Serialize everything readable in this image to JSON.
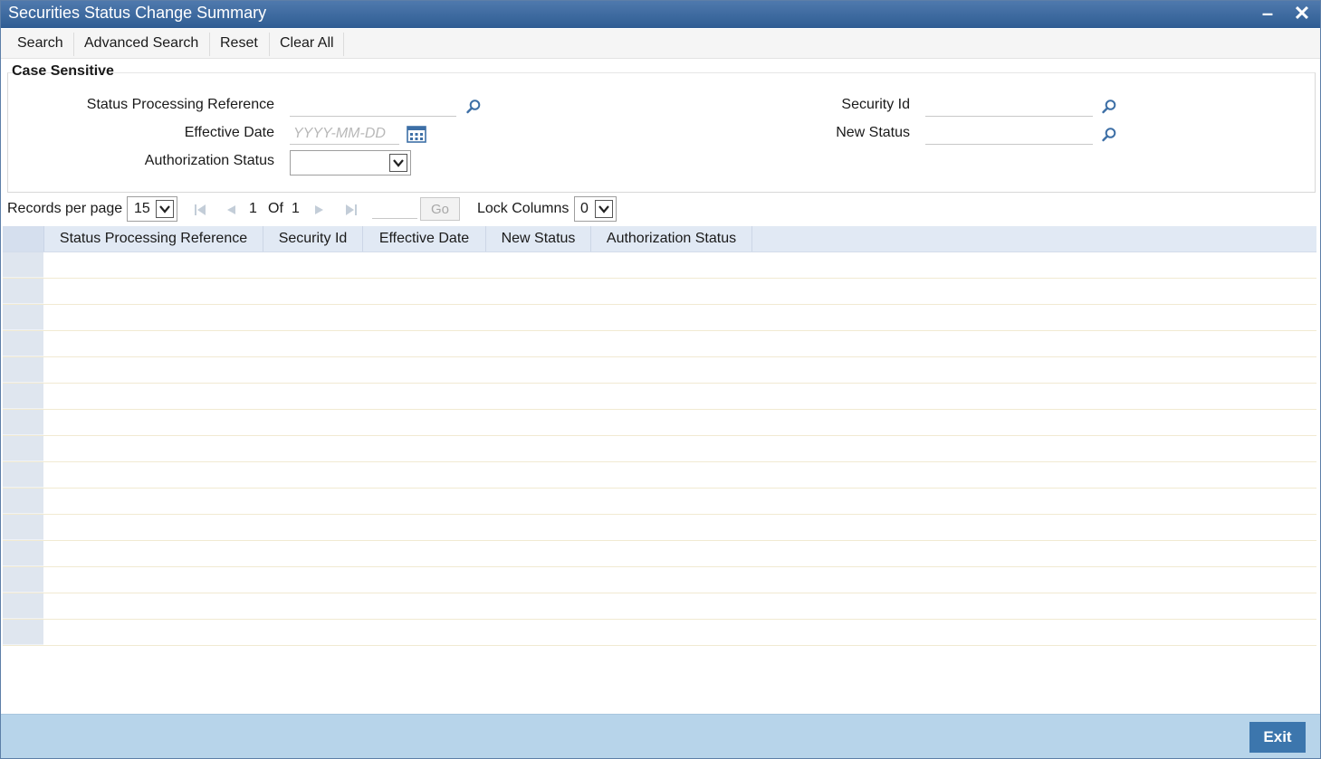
{
  "window": {
    "title": "Securities Status Change Summary"
  },
  "toolbar": {
    "search": "Search",
    "advanced_search": "Advanced Search",
    "reset": "Reset",
    "clear_all": "Clear All"
  },
  "criteria": {
    "legend": "Case Sensitive",
    "status_processing_reference": {
      "label": "Status Processing Reference",
      "value": ""
    },
    "effective_date": {
      "label": "Effective Date",
      "value": "",
      "placeholder": "YYYY-MM-DD"
    },
    "authorization_status": {
      "label": "Authorization Status",
      "value": ""
    },
    "security_id": {
      "label": "Security Id",
      "value": ""
    },
    "new_status": {
      "label": "New Status",
      "value": ""
    }
  },
  "pager": {
    "records_label": "Records per page",
    "records_value": "15",
    "current_page": "1",
    "of_label": "Of",
    "total_pages": "1",
    "go_label": "Go",
    "lock_label": "Lock Columns",
    "lock_value": "0"
  },
  "grid": {
    "columns": [
      "Status Processing Reference",
      "Security Id",
      "Effective Date",
      "New Status",
      "Authorization Status"
    ],
    "row_count": 15
  },
  "footer": {
    "exit": "Exit"
  },
  "icons": {
    "minimize": "minimize-icon",
    "close": "close-icon",
    "lookup": "magnifier-icon",
    "calendar": "calendar-icon",
    "first": "first-page-icon",
    "prev": "previous-page-icon",
    "next": "next-page-icon",
    "last": "last-page-icon",
    "dropdown": "chevron-down-icon"
  },
  "colors": {
    "titlebar": "#3a669c",
    "header": "#e1e9f4",
    "footer": "#b7d4ea",
    "exit_button": "#3c76ad"
  }
}
